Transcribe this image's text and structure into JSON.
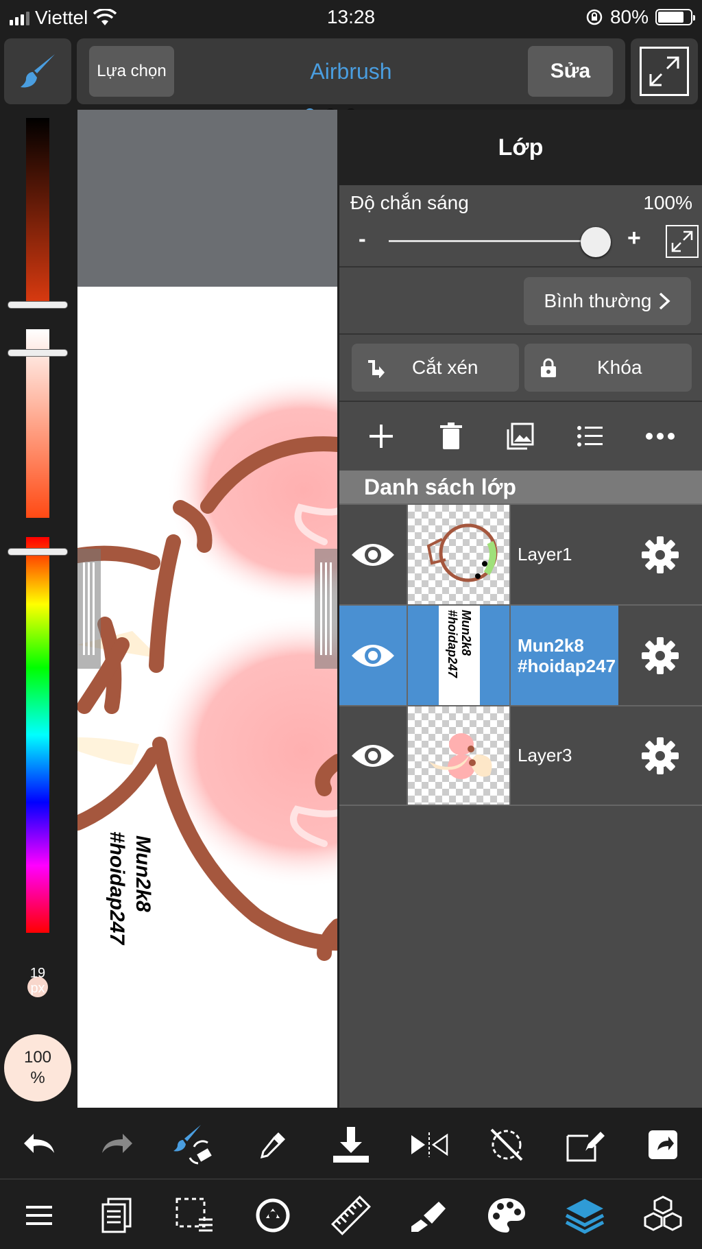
{
  "status_bar": {
    "carrier": "Viettel",
    "time": "13:28",
    "battery_percent": "80%",
    "battery_level": 0.8
  },
  "top_bar": {
    "select_label": "Lựa chọn",
    "brush_name": "Airbrush",
    "edit_label": "Sửa"
  },
  "canvas": {
    "watermark_line1": "Mun2k8",
    "watermark_line2": "#hoidap247"
  },
  "sidebar": {
    "brush_size": "19",
    "brush_size_unit": "px",
    "opacity_value": "100",
    "opacity_unit": "%"
  },
  "layer_panel": {
    "title": "Lớp",
    "opacity_label": "Độ chắn sáng",
    "opacity_value": "100%",
    "opacity_level": 1.0,
    "minus": "-",
    "plus": "+",
    "blend_mode": "Bình thường",
    "clip_label": "Cắt xén",
    "lock_label": "Khóa",
    "list_header": "Danh sách lớp",
    "layers": [
      {
        "name": "Layer1",
        "active": false
      },
      {
        "name": "Mun2k8\n#hoidap247",
        "active": true
      },
      {
        "name": "Layer3",
        "active": false
      }
    ]
  },
  "colors": {
    "accent": "#4a9ee0",
    "active_layer": "#4a90d2",
    "panel_bg": "#4a4a4a",
    "toolbar_bg": "#3a3a3a"
  },
  "toolbar_icons": {
    "row1": [
      "undo-icon",
      "redo-icon",
      "brush-eraser-swap-icon",
      "eyedropper-icon",
      "download-icon",
      "flip-icon",
      "rotate-off-icon",
      "transform-icon",
      "share-icon"
    ],
    "row2": [
      "menu-icon",
      "pages-icon",
      "selection-icon",
      "snap-icon",
      "ruler-icon",
      "fill-icon",
      "palette-icon",
      "layers-icon",
      "3d-icon"
    ]
  }
}
